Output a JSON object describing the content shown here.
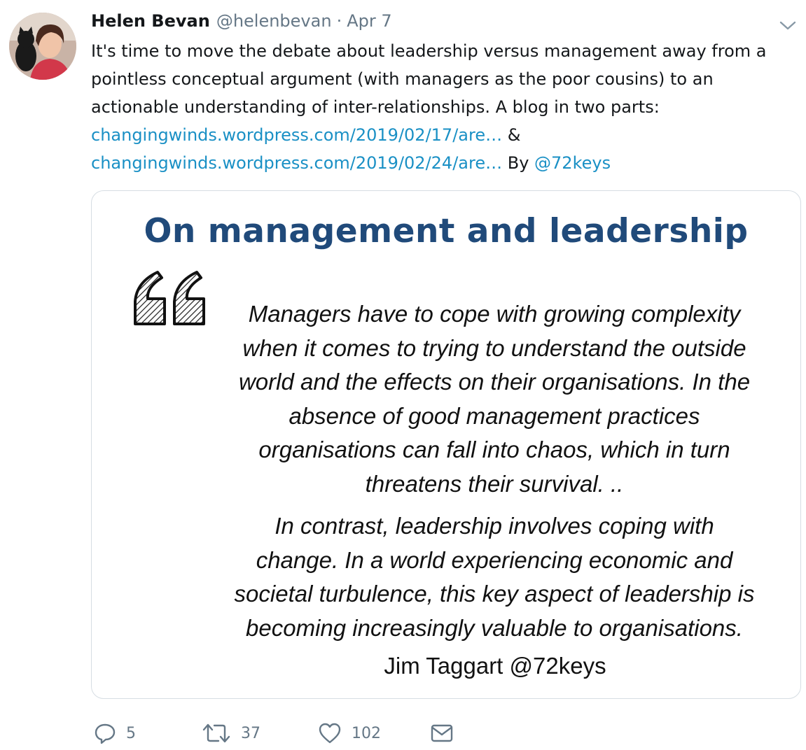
{
  "tweet": {
    "author_name": "Helen Bevan",
    "handle": "@helenbevan",
    "separator": "·",
    "date": "Apr 7",
    "text_lines": [
      "It's time to move the debate about leadership versus management away from a",
      "pointless conceptual argument (with managers as the poor cousins) to an",
      "actionable understanding of inter-relationships. A blog in two parts:"
    ],
    "link1": "changingwinds.wordpress.com/2019/02/17/are…",
    "link1_suffix": " &",
    "link2": "changingwinds.wordpress.com/2019/02/24/are…",
    "by_text": " By ",
    "mention": "@72keys"
  },
  "card": {
    "title": "On management and leadership",
    "quote_para1": [
      "Managers have to cope with growing complexity",
      "when it comes to trying to understand the outside",
      "world and the effects on their organisations. In the",
      "absence of good management practices",
      "organisations can fall into chaos, which in turn",
      "threatens their survival. .."
    ],
    "quote_para2": [
      "In contrast, leadership involves coping with",
      "change. In a world experiencing economic and",
      "societal turbulence, this key aspect of leadership is",
      "becoming increasingly valuable to organisations."
    ],
    "attribution": "Jim Taggart @72keys",
    "title_color": "#204a7a"
  },
  "actions": {
    "reply_count": "5",
    "retweet_count": "37",
    "like_count": "102"
  },
  "icons": {
    "reply": "reply-icon",
    "retweet": "retweet-icon",
    "like": "heart-icon",
    "dm": "envelope-icon",
    "more": "chevron-down-icon"
  },
  "colors": {
    "link": "#1a90c5",
    "muted": "#657786",
    "text": "#14171a"
  }
}
